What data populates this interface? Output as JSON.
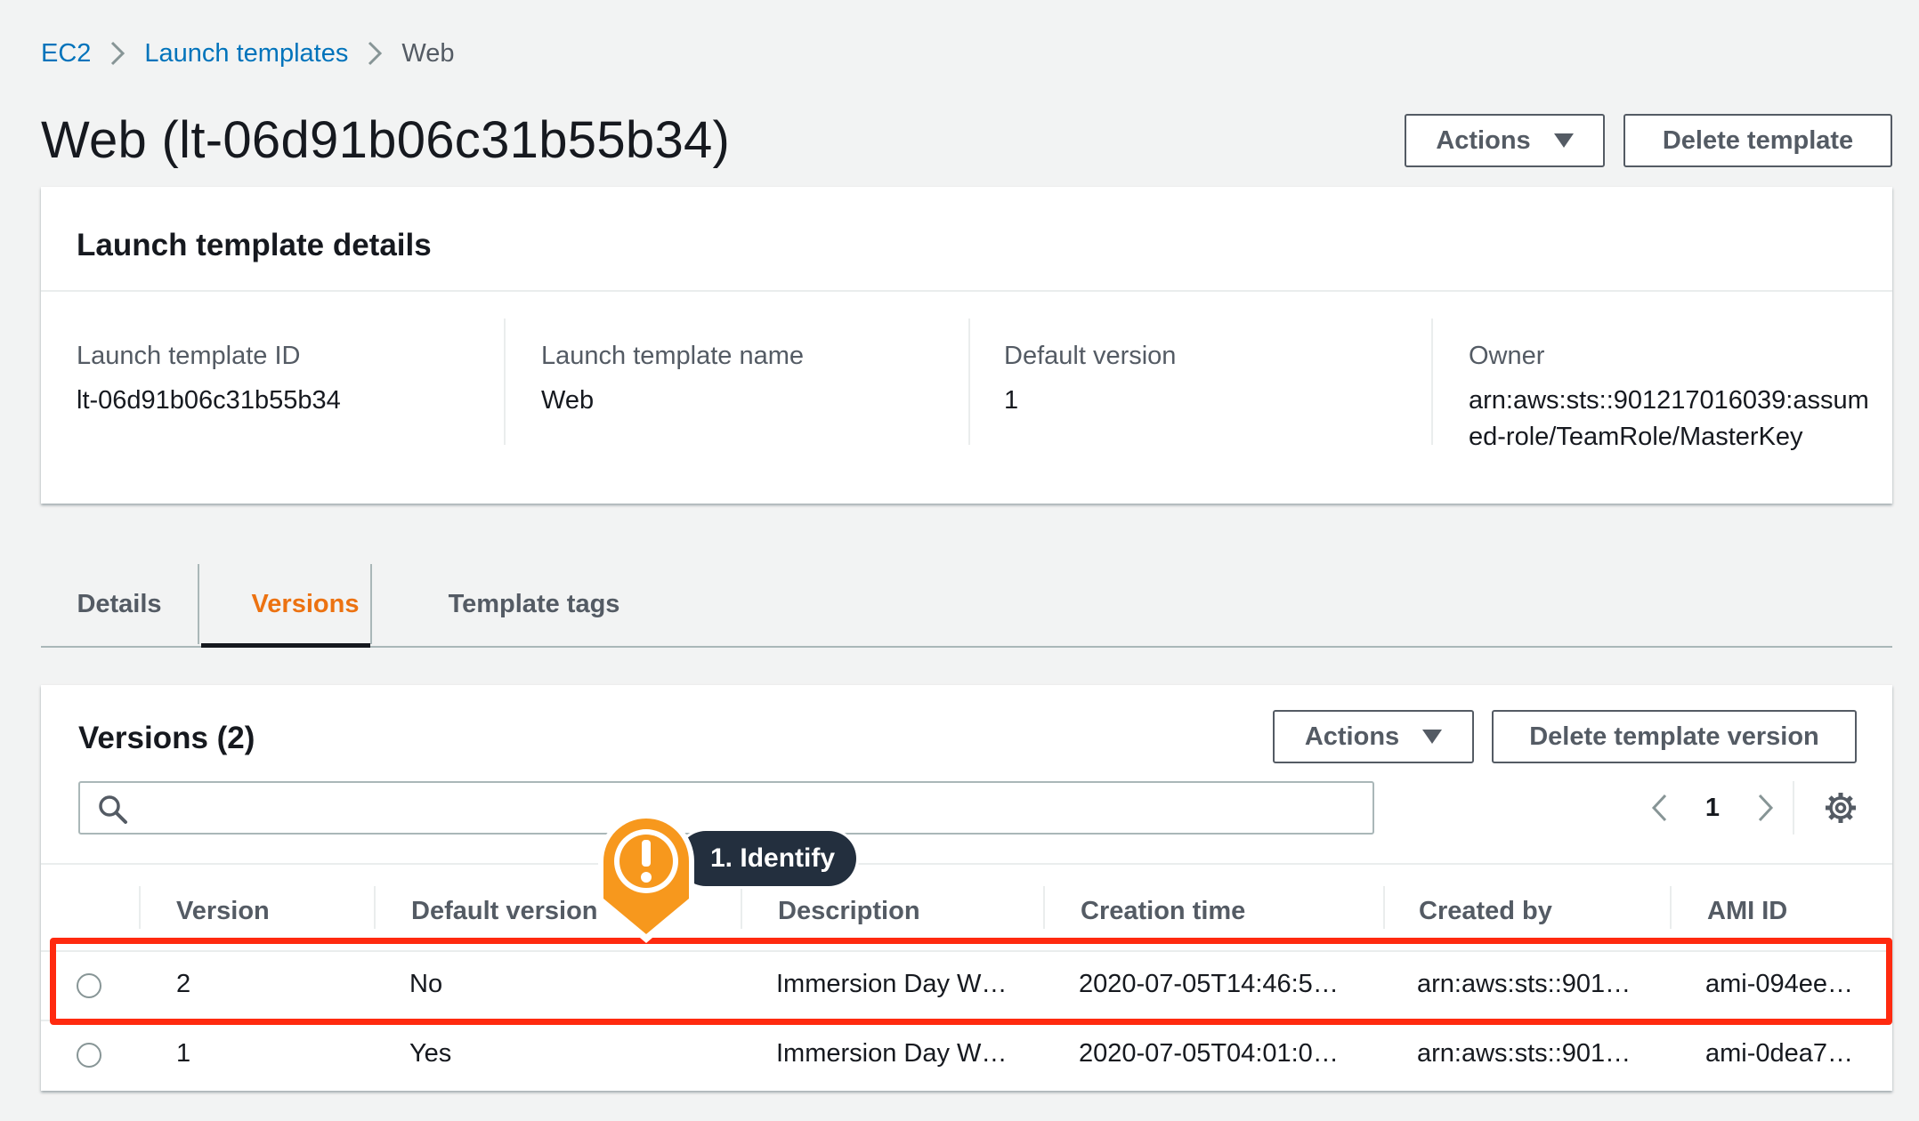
{
  "breadcrumb": {
    "items": [
      "EC2",
      "Launch templates"
    ],
    "current": "Web"
  },
  "page": {
    "title": "Web (lt-06d91b06c31b55b34)",
    "actions_label": "Actions",
    "delete_label": "Delete template"
  },
  "details": {
    "title": "Launch template details",
    "fields": [
      {
        "label": "Launch template ID",
        "value": "lt-06d91b06c31b55b34"
      },
      {
        "label": "Launch template name",
        "value": "Web"
      },
      {
        "label": "Default version",
        "value": "1"
      },
      {
        "label": "Owner",
        "value_line1": "arn:aws:sts::901217016039:assum",
        "value_line2": "ed-role/TeamRole/MasterKey"
      }
    ]
  },
  "tabs": [
    {
      "label": "Details",
      "active": false
    },
    {
      "label": "Versions",
      "active": true
    },
    {
      "label": "Template tags",
      "active": false
    }
  ],
  "versions": {
    "title": "Versions (2)",
    "actions_label": "Actions",
    "delete_label": "Delete template version",
    "search": {
      "value": "",
      "placeholder": ""
    },
    "page_number": "1",
    "columns": [
      "Version",
      "Default version",
      "Description",
      "Creation time",
      "Created by",
      "AMI ID"
    ],
    "rows": [
      {
        "version": "2",
        "default_version": "No",
        "description": "Immersion Day W…",
        "creation_time": "2020-07-05T14:46:5…",
        "created_by": "arn:aws:sts::901…",
        "ami_id": "ami-094ee…"
      },
      {
        "version": "1",
        "default_version": "Yes",
        "description": "Immersion Day W…",
        "creation_time": "2020-07-05T04:01:0…",
        "created_by": "arn:aws:sts::901…",
        "ami_id": "ami-0dea7…"
      }
    ]
  },
  "callout": {
    "label": "1. Identify",
    "badge_symbol": "!",
    "color": "#f7981d"
  },
  "colors": {
    "link": "#0073bb",
    "active_tab": "#ec7211",
    "highlight": "#ff2a0f",
    "callout_label_bg": "#232f3e"
  }
}
